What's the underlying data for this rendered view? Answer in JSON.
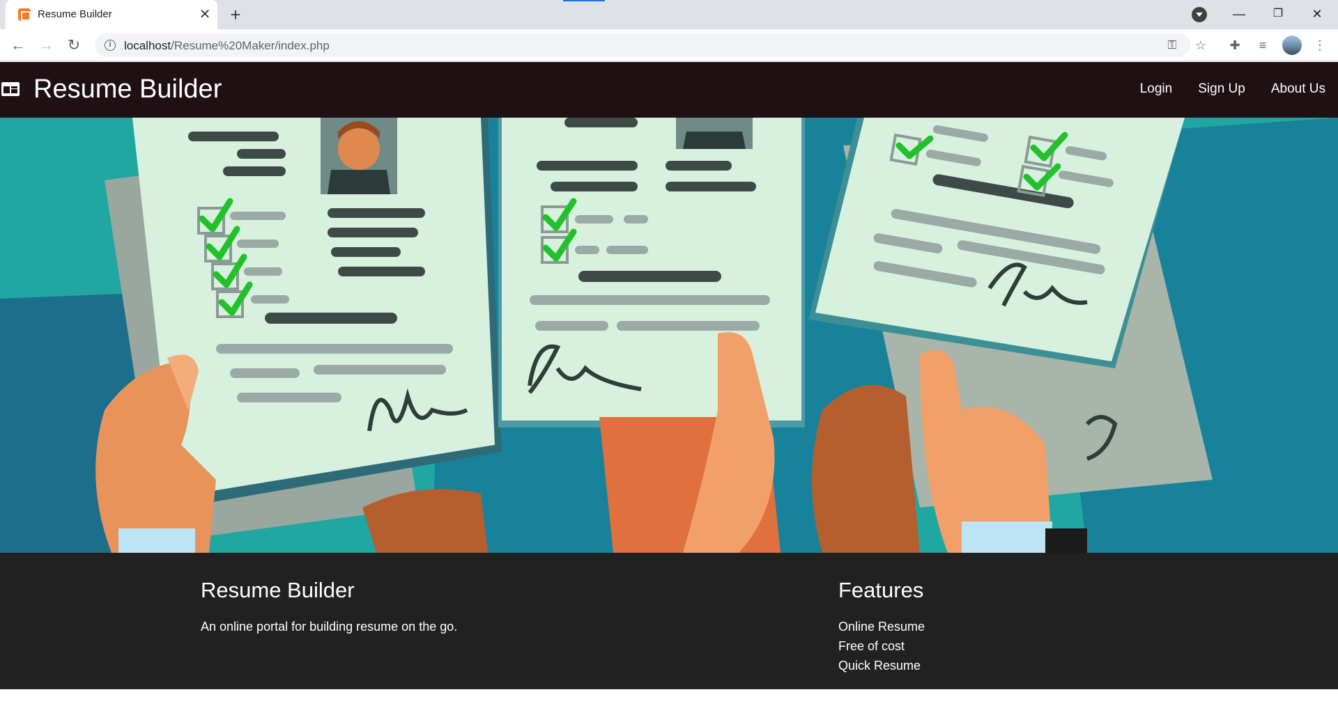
{
  "browser": {
    "tab_title": "Resume Builder",
    "url_host": "localhost",
    "url_path": "/Resume%20Maker/index.php",
    "icons": [
      "back-icon",
      "forward-icon",
      "reload-icon",
      "info-icon",
      "key-icon",
      "star-icon",
      "extensions-icon",
      "media-icon",
      "avatar",
      "more-icon",
      "minimize-icon",
      "maximize-icon",
      "close-icon"
    ]
  },
  "navbar": {
    "brand": "Resume Builder",
    "links": [
      {
        "label": "Login"
      },
      {
        "label": "Sign Up"
      },
      {
        "label": "About Us"
      }
    ],
    "background": "#1f1013"
  },
  "hero": {
    "background": "#20a7a2"
  },
  "footer": {
    "about_title": "Resume Builder",
    "about_text": "An online portal for building resume on the go.",
    "features_title": "Features",
    "features": [
      "Online Resume",
      "Free of cost",
      "Quick Resume"
    ],
    "background": "#212121"
  }
}
